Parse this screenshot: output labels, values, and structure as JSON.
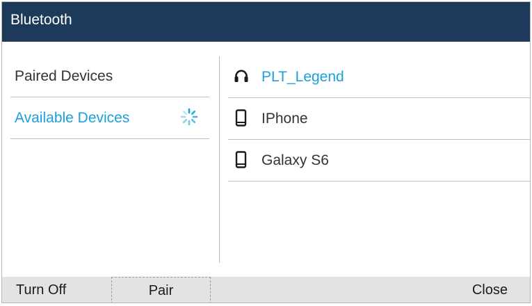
{
  "header": {
    "title": "Bluetooth"
  },
  "left_menu": {
    "items": [
      {
        "label": "Paired Devices",
        "selected": false
      },
      {
        "label": "Available Devices",
        "selected": true
      }
    ]
  },
  "devices": [
    {
      "name": "PLT_Legend",
      "icon": "headset-icon",
      "highlighted": true
    },
    {
      "name": "IPhone",
      "icon": "phone-icon",
      "highlighted": false
    },
    {
      "name": "Galaxy S6",
      "icon": "phone-icon",
      "highlighted": false
    }
  ],
  "softkeys": {
    "turn_off": "Turn Off",
    "pair": "Pair",
    "close": "Close"
  },
  "colors": {
    "title_bar": "#1e3a5a",
    "accent": "#1aa0dc",
    "text": "#333333",
    "softkey_bar": "#e3e3e3"
  }
}
